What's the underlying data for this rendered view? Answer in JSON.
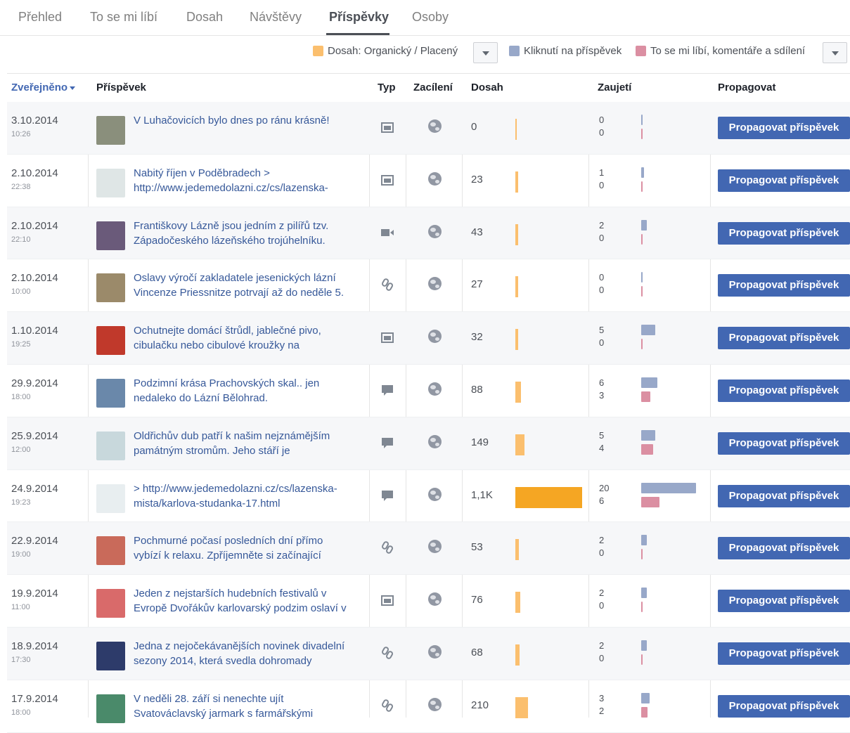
{
  "tabs": [
    "Přehled",
    "To se mi líbí",
    "Dosah",
    "Návštěvy",
    "Příspěvky",
    "Osoby"
  ],
  "legend": {
    "reach": "Dosah: Organický / Placený",
    "clicks": "Kliknutí na příspěvek",
    "likes": "To se mi líbí, komentáře a sdílení"
  },
  "colors": {
    "reach_organic": "#fbbf6e",
    "reach_paid": "#f5a623",
    "clicks": "#98a8c9",
    "likes": "#db8fa2",
    "button": "#4267b2",
    "link": "#365899"
  },
  "columns": {
    "published": "Zveřejněno",
    "post": "Příspěvek",
    "type": "Typ",
    "targeting": "Zacílení",
    "reach": "Dosah",
    "engagement": "Zaujetí",
    "promote": "Propagovat"
  },
  "button_label": "Propagovat příspěvek",
  "rows": [
    {
      "date": "3.10.2014",
      "time": "10:26",
      "text1": "V Luhačovicích bylo dnes po ránu krásně!",
      "text2": "",
      "type": "photo-icon",
      "reach": "0",
      "reach_value": 0,
      "eng_clicks": "0",
      "eng_likes": "0",
      "clicks_value": 0,
      "likes_value": 0
    },
    {
      "date": "2.10.2014",
      "time": "22:38",
      "text1": "Nabitý říjen v Poděbradech >",
      "text2": "http://www.jedemedolazni.cz/cs/lazenska-",
      "type": "photo-icon",
      "reach": "23",
      "reach_value": 23,
      "eng_clicks": "1",
      "eng_likes": "0",
      "clicks_value": 1,
      "likes_value": 0
    },
    {
      "date": "2.10.2014",
      "time": "22:10",
      "text1": "Františkovy Lázně jsou jedním z pilířů tzv.",
      "text2": "Západočeského lázeňského trojúhelníku.",
      "type": "video-icon",
      "reach": "43",
      "reach_value": 43,
      "eng_clicks": "2",
      "eng_likes": "0",
      "clicks_value": 2,
      "likes_value": 0
    },
    {
      "date": "2.10.2014",
      "time": "10:00",
      "text1": "Oslavy výročí zakladatele jesenických lázní",
      "text2": "Vincenze Priessnitze potrvají až do neděle 5.",
      "type": "link-icon",
      "reach": "27",
      "reach_value": 27,
      "eng_clicks": "0",
      "eng_likes": "0",
      "clicks_value": 0,
      "likes_value": 0
    },
    {
      "date": "1.10.2014",
      "time": "19:25",
      "text1": "Ochutnejte domácí štrůdl, jablečné pivo,",
      "text2": "cibulačku nebo cibulové kroužky na",
      "type": "photo-icon",
      "reach": "32",
      "reach_value": 32,
      "eng_clicks": "5",
      "eng_likes": "0",
      "clicks_value": 5,
      "likes_value": 0
    },
    {
      "date": "29.9.2014",
      "time": "18:00",
      "text1": "Podzimní krása Prachovských skal.. jen",
      "text2": "nedaleko do Lázní Bělohrad.",
      "type": "status-icon",
      "reach": "88",
      "reach_value": 88,
      "eng_clicks": "6",
      "eng_likes": "3",
      "clicks_value": 6,
      "likes_value": 3
    },
    {
      "date": "25.9.2014",
      "time": "12:00",
      "text1": "Oldřichův dub patří k našim nejznámějším",
      "text2": "památným stromům. Jeho stáří je",
      "type": "status-icon",
      "reach": "149",
      "reach_value": 149,
      "eng_clicks": "5",
      "eng_likes": "4",
      "clicks_value": 5,
      "likes_value": 4
    },
    {
      "date": "24.9.2014",
      "time": "19:23",
      "text1": "> http://www.jedemedolazni.cz/cs/lazenska-",
      "text2": "mista/karlova-studanka-17.html",
      "type": "status-icon",
      "reach": "1,1K",
      "reach_value": 1100,
      "reach_paid": true,
      "eng_clicks": "20",
      "eng_likes": "6",
      "clicks_value": 20,
      "likes_value": 6
    },
    {
      "date": "22.9.2014",
      "time": "19:00",
      "text1": "Pochmurné počasí posledních dní přímo",
      "text2": "vybízí k relaxu. Zpříjemněte si začínající",
      "type": "link-icon",
      "reach": "53",
      "reach_value": 53,
      "eng_clicks": "2",
      "eng_likes": "0",
      "clicks_value": 2,
      "likes_value": 0
    },
    {
      "date": "19.9.2014",
      "time": "11:00",
      "text1": "Jeden z nejstarších hudebních festivalů v",
      "text2": "Evropě Dvořákův karlovarský podzim oslaví v",
      "type": "photo-icon",
      "reach": "76",
      "reach_value": 76,
      "eng_clicks": "2",
      "eng_likes": "0",
      "clicks_value": 2,
      "likes_value": 0
    },
    {
      "date": "18.9.2014",
      "time": "17:30",
      "text1": "Jedna z nejočekávanějších novinek divadelní",
      "text2": "sezony 2014, která svedla dohromady",
      "type": "link-icon",
      "reach": "68",
      "reach_value": 68,
      "eng_clicks": "2",
      "eng_likes": "0",
      "clicks_value": 2,
      "likes_value": 0
    },
    {
      "date": "17.9.2014",
      "time": "18:00",
      "text1": "V neděli 28. září si nenechte ujít",
      "text2": "Svatováclavský jarmark s farmářskými",
      "type": "link-icon",
      "reach": "210",
      "reach_value": 210,
      "eng_clicks": "3",
      "eng_likes": "2",
      "clicks_value": 3,
      "likes_value": 2
    }
  ]
}
